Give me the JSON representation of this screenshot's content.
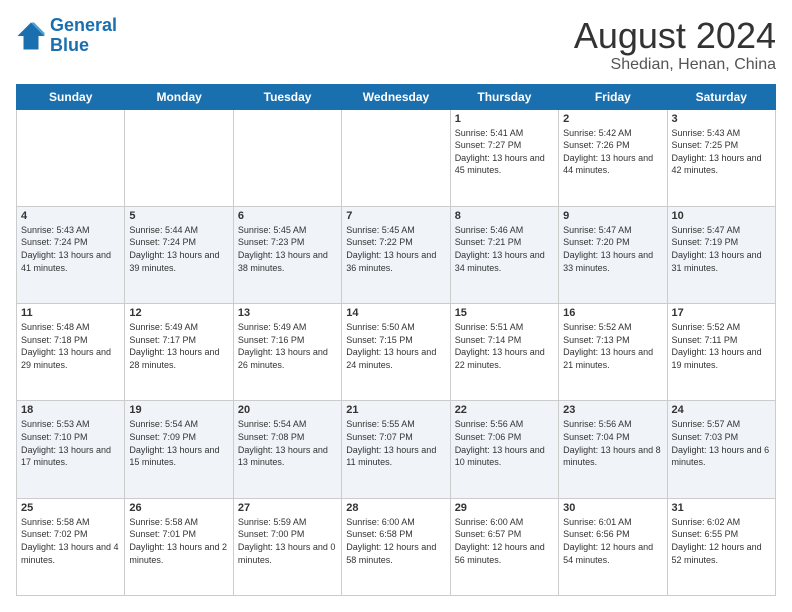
{
  "logo": {
    "line1": "General",
    "line2": "Blue"
  },
  "title": "August 2024",
  "subtitle": "Shedian, Henan, China",
  "days_of_week": [
    "Sunday",
    "Monday",
    "Tuesday",
    "Wednesday",
    "Thursday",
    "Friday",
    "Saturday"
  ],
  "weeks": [
    [
      {
        "day": "",
        "sunrise": "",
        "sunset": "",
        "daylight": ""
      },
      {
        "day": "",
        "sunrise": "",
        "sunset": "",
        "daylight": ""
      },
      {
        "day": "",
        "sunrise": "",
        "sunset": "",
        "daylight": ""
      },
      {
        "day": "",
        "sunrise": "",
        "sunset": "",
        "daylight": ""
      },
      {
        "day": "1",
        "sunrise": "Sunrise: 5:41 AM",
        "sunset": "Sunset: 7:27 PM",
        "daylight": "Daylight: 13 hours and 45 minutes."
      },
      {
        "day": "2",
        "sunrise": "Sunrise: 5:42 AM",
        "sunset": "Sunset: 7:26 PM",
        "daylight": "Daylight: 13 hours and 44 minutes."
      },
      {
        "day": "3",
        "sunrise": "Sunrise: 5:43 AM",
        "sunset": "Sunset: 7:25 PM",
        "daylight": "Daylight: 13 hours and 42 minutes."
      }
    ],
    [
      {
        "day": "4",
        "sunrise": "Sunrise: 5:43 AM",
        "sunset": "Sunset: 7:24 PM",
        "daylight": "Daylight: 13 hours and 41 minutes."
      },
      {
        "day": "5",
        "sunrise": "Sunrise: 5:44 AM",
        "sunset": "Sunset: 7:24 PM",
        "daylight": "Daylight: 13 hours and 39 minutes."
      },
      {
        "day": "6",
        "sunrise": "Sunrise: 5:45 AM",
        "sunset": "Sunset: 7:23 PM",
        "daylight": "Daylight: 13 hours and 38 minutes."
      },
      {
        "day": "7",
        "sunrise": "Sunrise: 5:45 AM",
        "sunset": "Sunset: 7:22 PM",
        "daylight": "Daylight: 13 hours and 36 minutes."
      },
      {
        "day": "8",
        "sunrise": "Sunrise: 5:46 AM",
        "sunset": "Sunset: 7:21 PM",
        "daylight": "Daylight: 13 hours and 34 minutes."
      },
      {
        "day": "9",
        "sunrise": "Sunrise: 5:47 AM",
        "sunset": "Sunset: 7:20 PM",
        "daylight": "Daylight: 13 hours and 33 minutes."
      },
      {
        "day": "10",
        "sunrise": "Sunrise: 5:47 AM",
        "sunset": "Sunset: 7:19 PM",
        "daylight": "Daylight: 13 hours and 31 minutes."
      }
    ],
    [
      {
        "day": "11",
        "sunrise": "Sunrise: 5:48 AM",
        "sunset": "Sunset: 7:18 PM",
        "daylight": "Daylight: 13 hours and 29 minutes."
      },
      {
        "day": "12",
        "sunrise": "Sunrise: 5:49 AM",
        "sunset": "Sunset: 7:17 PM",
        "daylight": "Daylight: 13 hours and 28 minutes."
      },
      {
        "day": "13",
        "sunrise": "Sunrise: 5:49 AM",
        "sunset": "Sunset: 7:16 PM",
        "daylight": "Daylight: 13 hours and 26 minutes."
      },
      {
        "day": "14",
        "sunrise": "Sunrise: 5:50 AM",
        "sunset": "Sunset: 7:15 PM",
        "daylight": "Daylight: 13 hours and 24 minutes."
      },
      {
        "day": "15",
        "sunrise": "Sunrise: 5:51 AM",
        "sunset": "Sunset: 7:14 PM",
        "daylight": "Daylight: 13 hours and 22 minutes."
      },
      {
        "day": "16",
        "sunrise": "Sunrise: 5:52 AM",
        "sunset": "Sunset: 7:13 PM",
        "daylight": "Daylight: 13 hours and 21 minutes."
      },
      {
        "day": "17",
        "sunrise": "Sunrise: 5:52 AM",
        "sunset": "Sunset: 7:11 PM",
        "daylight": "Daylight: 13 hours and 19 minutes."
      }
    ],
    [
      {
        "day": "18",
        "sunrise": "Sunrise: 5:53 AM",
        "sunset": "Sunset: 7:10 PM",
        "daylight": "Daylight: 13 hours and 17 minutes."
      },
      {
        "day": "19",
        "sunrise": "Sunrise: 5:54 AM",
        "sunset": "Sunset: 7:09 PM",
        "daylight": "Daylight: 13 hours and 15 minutes."
      },
      {
        "day": "20",
        "sunrise": "Sunrise: 5:54 AM",
        "sunset": "Sunset: 7:08 PM",
        "daylight": "Daylight: 13 hours and 13 minutes."
      },
      {
        "day": "21",
        "sunrise": "Sunrise: 5:55 AM",
        "sunset": "Sunset: 7:07 PM",
        "daylight": "Daylight: 13 hours and 11 minutes."
      },
      {
        "day": "22",
        "sunrise": "Sunrise: 5:56 AM",
        "sunset": "Sunset: 7:06 PM",
        "daylight": "Daylight: 13 hours and 10 minutes."
      },
      {
        "day": "23",
        "sunrise": "Sunrise: 5:56 AM",
        "sunset": "Sunset: 7:04 PM",
        "daylight": "Daylight: 13 hours and 8 minutes."
      },
      {
        "day": "24",
        "sunrise": "Sunrise: 5:57 AM",
        "sunset": "Sunset: 7:03 PM",
        "daylight": "Daylight: 13 hours and 6 minutes."
      }
    ],
    [
      {
        "day": "25",
        "sunrise": "Sunrise: 5:58 AM",
        "sunset": "Sunset: 7:02 PM",
        "daylight": "Daylight: 13 hours and 4 minutes."
      },
      {
        "day": "26",
        "sunrise": "Sunrise: 5:58 AM",
        "sunset": "Sunset: 7:01 PM",
        "daylight": "Daylight: 13 hours and 2 minutes."
      },
      {
        "day": "27",
        "sunrise": "Sunrise: 5:59 AM",
        "sunset": "Sunset: 7:00 PM",
        "daylight": "Daylight: 13 hours and 0 minutes."
      },
      {
        "day": "28",
        "sunrise": "Sunrise: 6:00 AM",
        "sunset": "Sunset: 6:58 PM",
        "daylight": "Daylight: 12 hours and 58 minutes."
      },
      {
        "day": "29",
        "sunrise": "Sunrise: 6:00 AM",
        "sunset": "Sunset: 6:57 PM",
        "daylight": "Daylight: 12 hours and 56 minutes."
      },
      {
        "day": "30",
        "sunrise": "Sunrise: 6:01 AM",
        "sunset": "Sunset: 6:56 PM",
        "daylight": "Daylight: 12 hours and 54 minutes."
      },
      {
        "day": "31",
        "sunrise": "Sunrise: 6:02 AM",
        "sunset": "Sunset: 6:55 PM",
        "daylight": "Daylight: 12 hours and 52 minutes."
      }
    ]
  ]
}
